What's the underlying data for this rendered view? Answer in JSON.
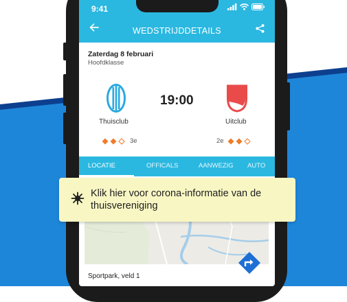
{
  "status_bar": {
    "time": "9:41"
  },
  "header": {
    "title": "WEDSTRIJDDETAILS",
    "back_icon": "arrow-left-icon",
    "share_icon": "share-icon"
  },
  "match": {
    "date": "Zaterdag 8 februari",
    "league": "Hoofdklasse",
    "kickoff": "19:00",
    "home": {
      "name": "Thuisclub",
      "rank": "3e",
      "diamonds": [
        true,
        false,
        false
      ],
      "logo_icon": "striped-shield-icon"
    },
    "away": {
      "name": "Uitclub",
      "rank": "2e",
      "diamonds": [
        true,
        true,
        false
      ],
      "logo_icon": "red-shield-icon"
    }
  },
  "tabs": [
    {
      "label": "LOCATIE",
      "active": true
    },
    {
      "label": "OFFICALS",
      "active": false
    },
    {
      "label": "AANWEZIG",
      "active": false
    },
    {
      "label": "AUTO",
      "active": false
    }
  ],
  "location": {
    "venue": "Sportpark, veld 1",
    "directions_icon": "directions-icon"
  },
  "banner": {
    "text": "Klik hier voor corona-informatie van de thuisvereniging",
    "icon": "virus-icon"
  },
  "colors": {
    "primary": "#2bb8e0",
    "accent_orange": "#f07b2a",
    "away_red": "#e94b4b",
    "home_blue": "#29a9e0",
    "stripe_blue": "#1e86d9",
    "stripe_dark": "#0d3f8f",
    "banner_bg": "#f8f7c4",
    "directions": "#1d6fd4"
  }
}
